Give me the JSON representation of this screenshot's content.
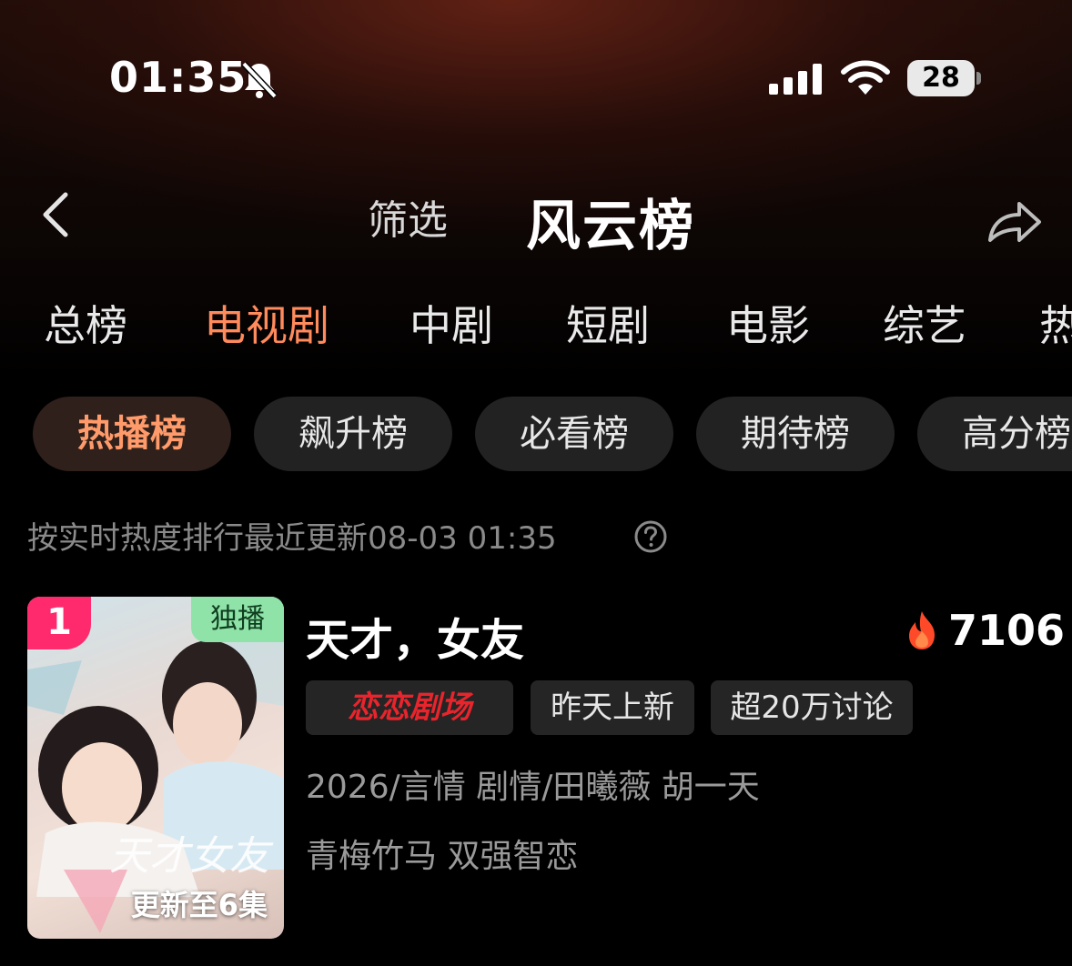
{
  "status_bar": {
    "time": "01:35",
    "battery": "28"
  },
  "nav": {
    "filter_label": "筛选",
    "title": "风云榜"
  },
  "categories": [
    {
      "label": "总榜"
    },
    {
      "label": "电视剧",
      "active": true
    },
    {
      "label": "中剧"
    },
    {
      "label": "短剧"
    },
    {
      "label": "电影"
    },
    {
      "label": "综艺"
    },
    {
      "label": "热"
    }
  ],
  "sub_tabs": [
    {
      "label": "热播榜",
      "active": true
    },
    {
      "label": "飙升榜"
    },
    {
      "label": "必看榜"
    },
    {
      "label": "期待榜"
    },
    {
      "label": "高分榜"
    }
  ],
  "ranking_note": "按实时热度排行最近更新08-03 01:35",
  "items": [
    {
      "rank": "1",
      "exclusive_badge": "独播",
      "poster_overlay": "更新至6集",
      "title": "天才，女友",
      "heat": "7106",
      "tags": [
        "恋恋剧场",
        "昨天上新",
        "超20万讨论"
      ],
      "meta": "2026/言情 剧情/田曦薇 胡一天",
      "keywords": "青梅竹马 双强智恋"
    }
  ],
  "colors": {
    "accent": "#ff8a5c",
    "rank_badge": "#ff2a6d",
    "exclusive_badge": "#8fe3a8",
    "brand_tag": "#e8242c"
  }
}
